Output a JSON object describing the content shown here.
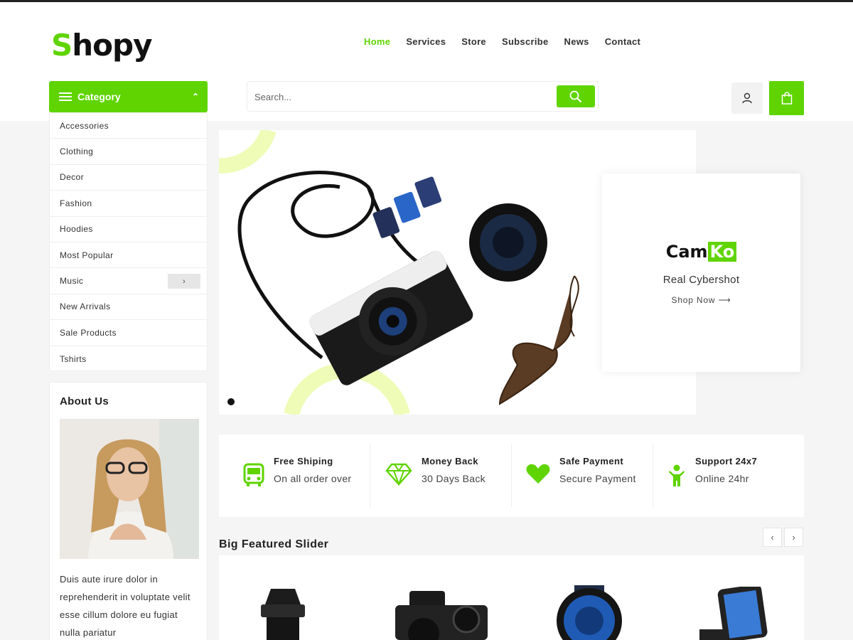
{
  "brand": {
    "logo_first": "S",
    "logo_rest": "hopy",
    "accent_color": "#5fd400"
  },
  "nav": [
    "Home",
    "Services",
    "Store",
    "Subscribe",
    "News",
    "Contact"
  ],
  "category": {
    "label": "Category",
    "items": [
      "Accessories",
      "Clothing",
      "Decor",
      "Fashion",
      "Hoodies",
      "Most Popular",
      "Music",
      "New Arrivals",
      "Sale Products",
      "Tshirts"
    ]
  },
  "search": {
    "placeholder": "Search..."
  },
  "hero": {
    "promo_brand_a": "Cam",
    "promo_brand_b": "Ko",
    "promo_tagline": "Real Cybershot",
    "promo_link": "Shop Now"
  },
  "about": {
    "title": "About Us",
    "text": "Duis aute irure dolor in reprehenderit in voluptate velit esse cillum dolore eu fugiat nulla pariatur"
  },
  "features": [
    {
      "title": "Free Shiping",
      "sub": "On all order over",
      "icon": "bus-icon"
    },
    {
      "title": "Money Back",
      "sub": "30 Days Back",
      "icon": "diamond-icon"
    },
    {
      "title": "Safe Payment",
      "sub": "Secure Payment",
      "icon": "heart-icon"
    },
    {
      "title": "Support 24x7",
      "sub": "Online 24hr",
      "icon": "person-icon"
    }
  ],
  "featured": {
    "title": "Big Featured Slider"
  }
}
